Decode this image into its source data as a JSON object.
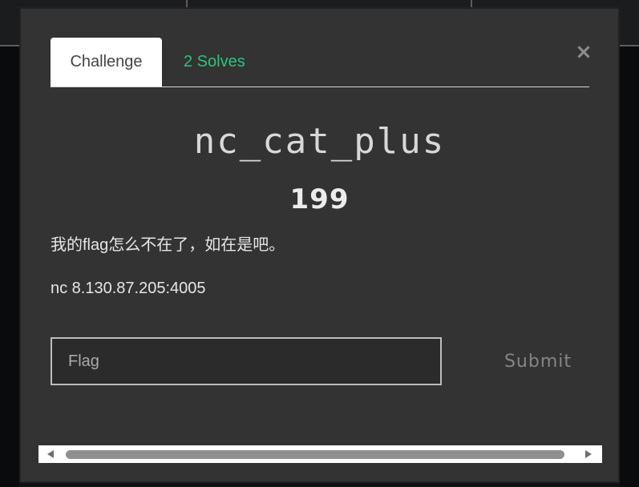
{
  "modal": {
    "close_symbol": "×",
    "tabs": [
      {
        "label": "Challenge",
        "active": true
      },
      {
        "label": "2 Solves",
        "active": false
      }
    ],
    "challenge": {
      "name": "nc_cat_plus",
      "value": "199",
      "description": [
        "我的flag怎么不在了，如在是吧。",
        "nc 8.130.87.205:4005"
      ]
    },
    "flag_input": {
      "placeholder": "Flag",
      "value": ""
    },
    "submit_label": "Submit"
  },
  "colors": {
    "modal_bg": "#333333",
    "solves_tab": "#2ec27e",
    "active_tab_bg": "#ffffff"
  },
  "icons": {
    "close": "close-icon",
    "scroll_left": "scroll-left-arrow-icon",
    "scroll_right": "scroll-right-arrow-icon"
  }
}
